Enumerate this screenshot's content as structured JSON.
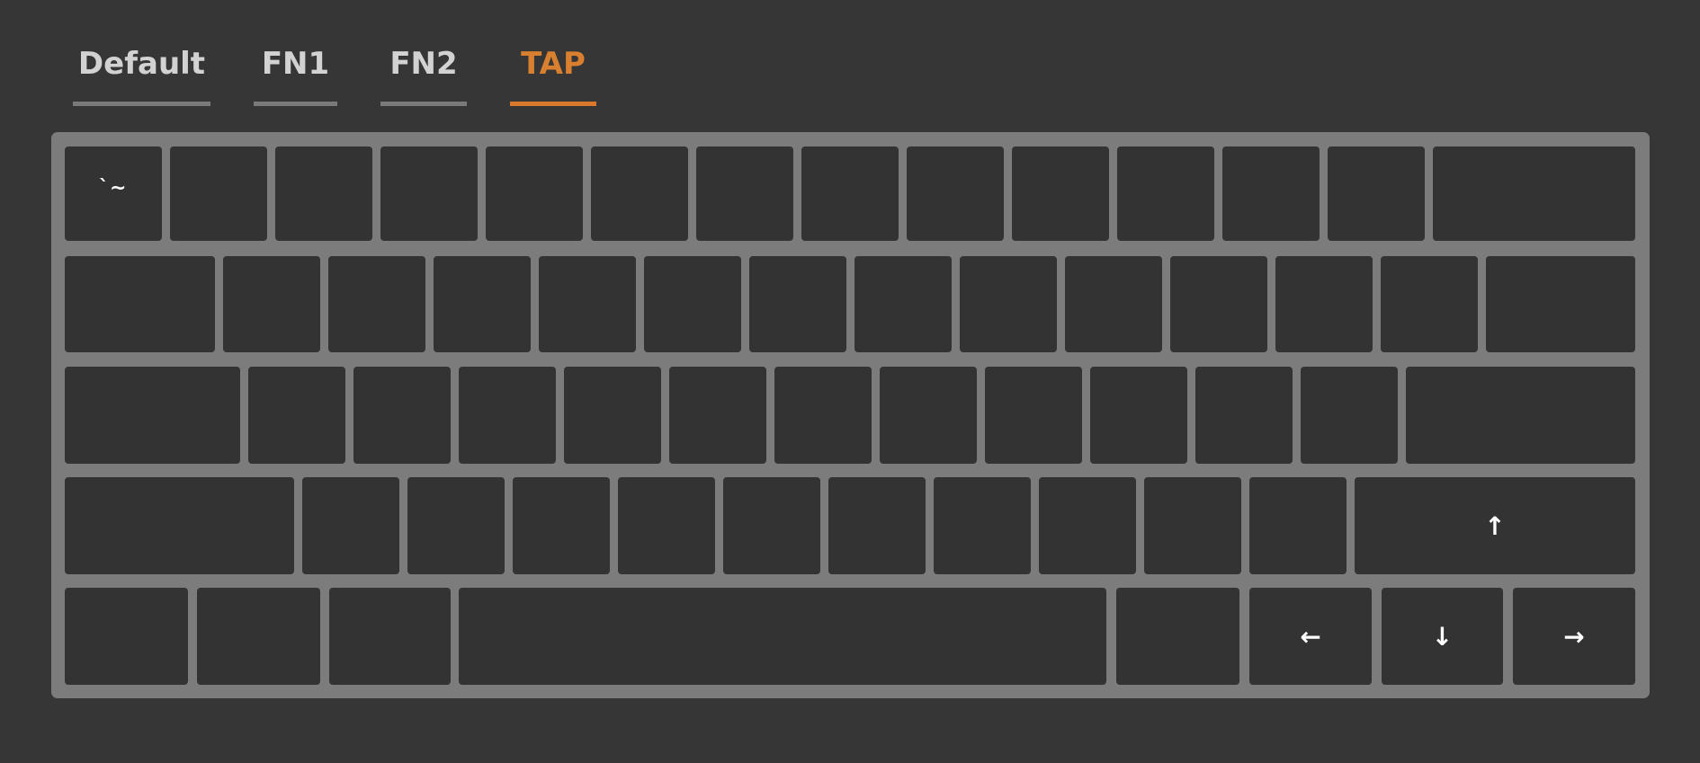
{
  "tabs": [
    {
      "label": "Default",
      "active": false
    },
    {
      "label": "FN1",
      "active": false
    },
    {
      "label": "FN2",
      "active": false
    },
    {
      "label": "TAP",
      "active": true
    }
  ],
  "colors": {
    "background": "#363636",
    "key": "#333333",
    "board": "#7c7c7c",
    "active_tab": "#d9782d",
    "inactive_underline": "#7a7a7a"
  },
  "keyboard": {
    "rows": [
      [
        {
          "legend": "`~",
          "icon": "backtick-tilde"
        },
        {
          "legend": ""
        },
        {
          "legend": ""
        },
        {
          "legend": ""
        },
        {
          "legend": ""
        },
        {
          "legend": ""
        },
        {
          "legend": ""
        },
        {
          "legend": ""
        },
        {
          "legend": ""
        },
        {
          "legend": ""
        },
        {
          "legend": ""
        },
        {
          "legend": ""
        },
        {
          "legend": ""
        },
        {
          "legend": ""
        }
      ],
      [
        {
          "legend": ""
        },
        {
          "legend": ""
        },
        {
          "legend": ""
        },
        {
          "legend": ""
        },
        {
          "legend": ""
        },
        {
          "legend": ""
        },
        {
          "legend": ""
        },
        {
          "legend": ""
        },
        {
          "legend": ""
        },
        {
          "legend": ""
        },
        {
          "legend": ""
        },
        {
          "legend": ""
        },
        {
          "legend": ""
        },
        {
          "legend": ""
        }
      ],
      [
        {
          "legend": ""
        },
        {
          "legend": ""
        },
        {
          "legend": ""
        },
        {
          "legend": ""
        },
        {
          "legend": ""
        },
        {
          "legend": ""
        },
        {
          "legend": ""
        },
        {
          "legend": ""
        },
        {
          "legend": ""
        },
        {
          "legend": ""
        },
        {
          "legend": ""
        },
        {
          "legend": ""
        },
        {
          "legend": ""
        }
      ],
      [
        {
          "legend": ""
        },
        {
          "legend": ""
        },
        {
          "legend": ""
        },
        {
          "legend": ""
        },
        {
          "legend": ""
        },
        {
          "legend": ""
        },
        {
          "legend": ""
        },
        {
          "legend": ""
        },
        {
          "legend": ""
        },
        {
          "legend": ""
        },
        {
          "legend": ""
        },
        {
          "legend": "↑",
          "icon": "arrow-up-icon"
        }
      ],
      [
        {
          "legend": ""
        },
        {
          "legend": ""
        },
        {
          "legend": ""
        },
        {
          "legend": ""
        },
        {
          "legend": ""
        },
        {
          "legend": "←",
          "icon": "arrow-left-icon"
        },
        {
          "legend": "↓",
          "icon": "arrow-down-icon"
        },
        {
          "legend": "→",
          "icon": "arrow-right-icon"
        }
      ]
    ]
  }
}
